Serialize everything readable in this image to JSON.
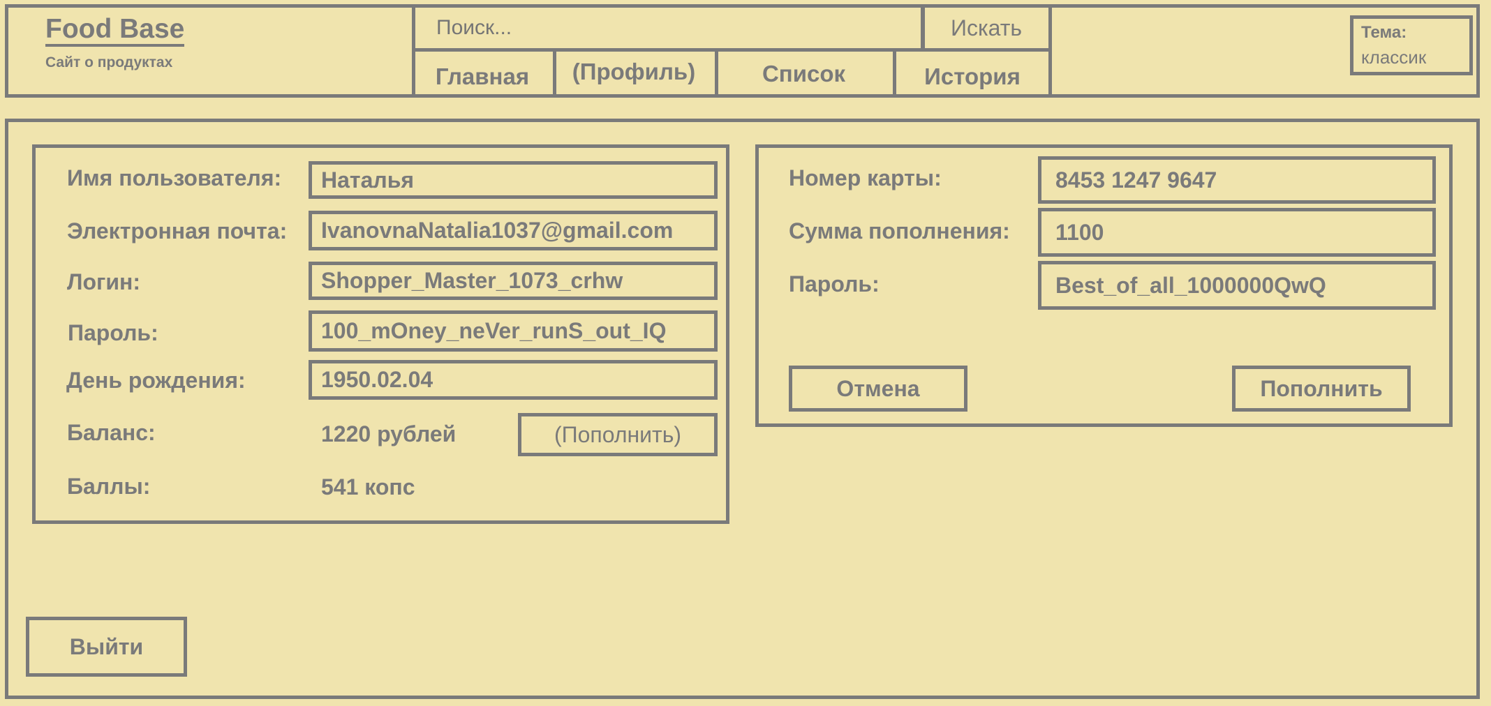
{
  "header": {
    "logo_title": "Food Base",
    "logo_subtitle": "Сайт о продуктах",
    "search_placeholder": "Поиск...",
    "search_button": "Искать",
    "theme_label": "Тема:",
    "theme_value": "классик"
  },
  "nav": [
    {
      "label": "Главная"
    },
    {
      "label": "(Профиль)"
    },
    {
      "label": "Список"
    },
    {
      "label": "История"
    }
  ],
  "profile": {
    "username_label": "Имя пользователя:",
    "username_value": "Наталья",
    "email_label": "Электронная почта:",
    "email_value": "IvanovnaNatalia1037@gmail.com",
    "login_label": "Логин:",
    "login_value": "Shopper_Master_1073_crhw",
    "password_label": "Пароль:",
    "password_value": "100_mOney_neVer_runS_out_IQ",
    "birthday_label": "День рождения:",
    "birthday_value": "1950.02.04",
    "balance_label": "Баланс:",
    "balance_value": "1220 рублей",
    "topup_button": "(Пополнить)",
    "points_label": "Баллы:",
    "points_value": "541 копс"
  },
  "topup": {
    "card_label": "Номер карты:",
    "card_value": "8453 1247 9647",
    "amount_label": "Сумма пополнения:",
    "amount_value": "1100",
    "password_label": "Пароль:",
    "password_value": "Best_of_all_1000000QwQ",
    "cancel_button": "Отмена",
    "submit_button": "Пополнить"
  },
  "logout_button": "Выйти"
}
